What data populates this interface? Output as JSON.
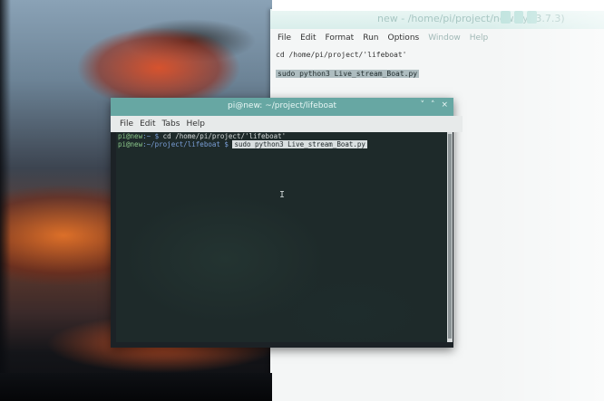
{
  "editor": {
    "title": "new - /home/pi/project/new.py (3.7.3)",
    "menu": [
      "File",
      "Edit",
      "Format",
      "Run",
      "Options",
      "Window",
      "Help"
    ],
    "code_line1": "cd /home/pi/project/'lifeboat'",
    "code_line2": "sudo python3 Live_stream_Boat.py"
  },
  "terminal": {
    "title": "pi@new: ~/project/lifeboat",
    "controls": [
      "˅",
      "˄",
      "×"
    ],
    "menu": [
      "File",
      "Edit",
      "Tabs",
      "Help"
    ],
    "line1": {
      "user": "pi@new",
      "path": ":~ $",
      "cmd": " cd /home/pi/project/'lifeboat'"
    },
    "line2": {
      "user": "pi@new",
      "path": ":~/project/lifeboat $",
      "cmd": "sudo python3 Live_stream_Boat.py"
    },
    "cursor_glyph": "I"
  }
}
